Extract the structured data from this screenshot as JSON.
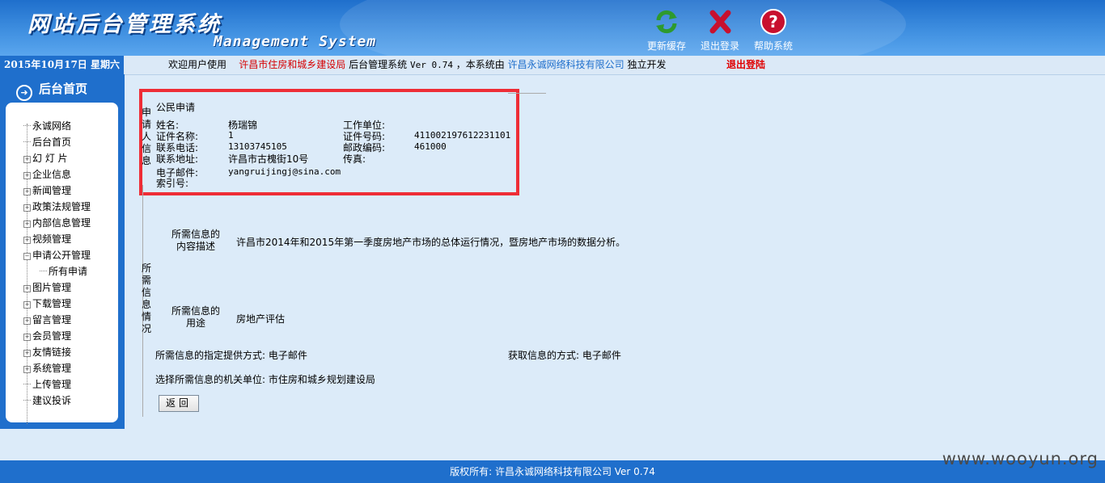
{
  "header": {
    "title_cn": "网站后台管理系统",
    "title_en": "Management System",
    "tools": [
      {
        "label": "更新缓存",
        "icon": "refresh-icon"
      },
      {
        "label": "退出登录",
        "icon": "close-icon"
      },
      {
        "label": "帮助系统",
        "icon": "help-icon"
      }
    ]
  },
  "infobar": {
    "date": "2015年10月17日 星期六",
    "welcome_prefix": "欢迎用户使用",
    "org": "许昌市住房和城乡建设局",
    "system": "后台管理系统",
    "version": "Ver 0.74",
    "by_prefix": "，本系统由",
    "company": "许昌永诚网络科技有限公司",
    "by_suffix": "独立开发",
    "logout": "退出登陆"
  },
  "sidebar": {
    "home": "后台首页",
    "items": [
      {
        "label": "永诚网络",
        "type": "leaf"
      },
      {
        "label": "后台首页",
        "type": "leaf"
      },
      {
        "label": "幻 灯 片",
        "type": "plus"
      },
      {
        "label": "企业信息",
        "type": "plus"
      },
      {
        "label": "新闻管理",
        "type": "plus"
      },
      {
        "label": "政策法规管理",
        "type": "plus"
      },
      {
        "label": "内部信息管理",
        "type": "plus"
      },
      {
        "label": "视频管理",
        "type": "plus"
      },
      {
        "label": "申请公开管理",
        "type": "minus"
      },
      {
        "label": "所有申请",
        "type": "child"
      },
      {
        "label": "图片管理",
        "type": "plus"
      },
      {
        "label": "下载管理",
        "type": "plus"
      },
      {
        "label": "留言管理",
        "type": "plus"
      },
      {
        "label": "会员管理",
        "type": "plus"
      },
      {
        "label": "友情链接",
        "type": "plus"
      },
      {
        "label": "系统管理",
        "type": "plus"
      },
      {
        "label": "上传管理",
        "type": "leaf"
      },
      {
        "label": "建议投诉",
        "type": "leaf"
      }
    ]
  },
  "applicant": {
    "section_label": "申请人信息",
    "type": "公民申请",
    "name_label": "姓名:",
    "name": "杨瑞锦",
    "work_label": "工作单位:",
    "work": "",
    "id_type_label": "证件名称:",
    "id_type": "1",
    "id_no_label": "证件号码:",
    "id_no": "411002197612231101",
    "phone_label": "联系电话:",
    "phone": "13103745105",
    "postcode_label": "邮政编码:",
    "postcode": "461000",
    "address_label": "联系地址:",
    "address": "许昌市古槐街10号",
    "fax_label": "传真:",
    "fax": "",
    "email_label": "电子邮件:",
    "email": "yangruijingj@sina.com",
    "index_label": "索引号:"
  },
  "request": {
    "section_label": "所需信息情况",
    "desc_label_1": "所需信息的",
    "desc_label_2": "内容描述",
    "desc": "许昌市2014年和2015年第一季度房地产市场的总体运行情况，暨房地产市场的数据分析。",
    "use_label_1": "所需信息的",
    "use_label_2": "用途",
    "use": "房地产评估",
    "provide_way": "所需信息的指定提供方式: 电子邮件",
    "obtain_way": "获取信息的方式: 电子邮件",
    "agency": "选择所需信息的机关单位: 市住房和城乡规划建设局",
    "back": "返回"
  },
  "footer": {
    "copyright": "版权所有: 许昌永诚网络科技有限公司 Ver 0.74"
  },
  "watermark": "www.wooyun.org"
}
